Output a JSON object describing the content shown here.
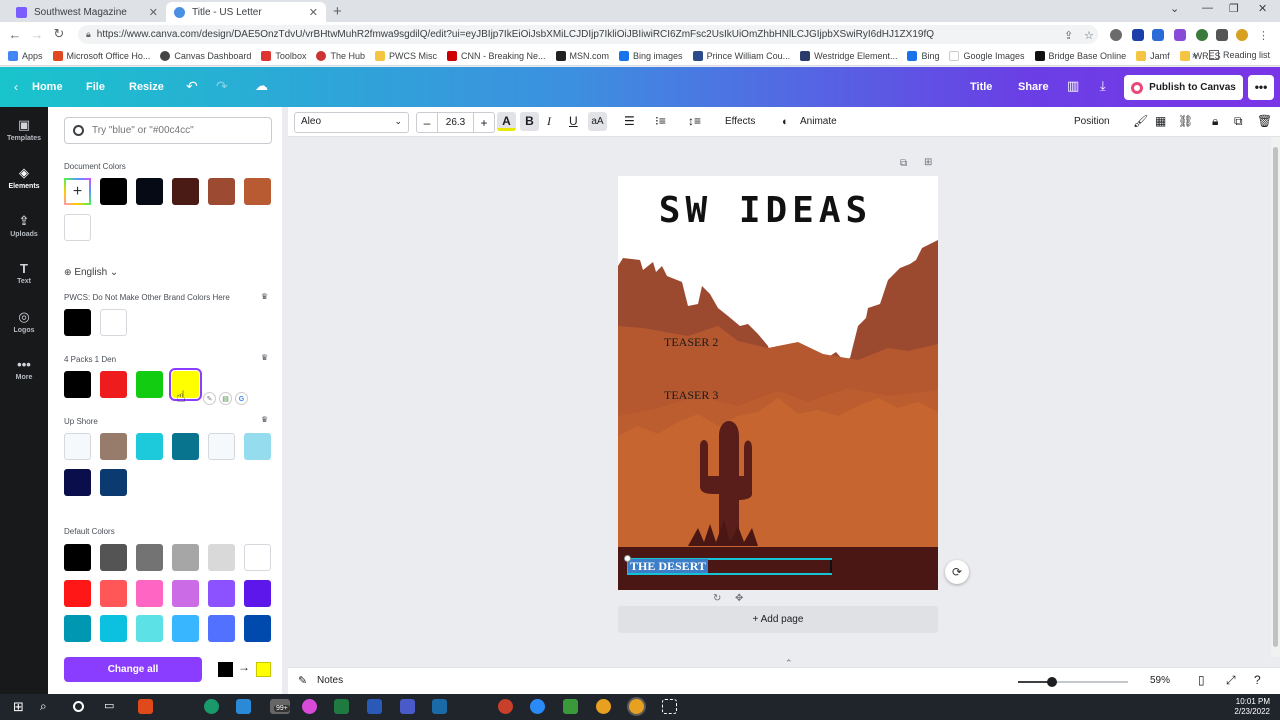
{
  "browser": {
    "tabs": [
      {
        "title": "Southwest Magazine",
        "active": false
      },
      {
        "title": "Title - US Letter",
        "active": true
      }
    ],
    "url": "https://www.canva.com/design/DAE5OnzTdvU/vrBHtwMuhR2fmwa9sgdilQ/edit?ui=eyJBIjp7IkEiOiJsbXMiLCJDIjp7IkliOiJBIiwiRCI6ZmFsc2UsIkUiOmZhbHNlLCJGIjpbXSwiRyI6dHJ1ZX19fQ",
    "bookmarks": [
      "Apps",
      "Microsoft Office Ho...",
      "Canvas Dashboard",
      "Toolbox",
      "The Hub",
      "PWCS Misc",
      "CNN - Breaking Ne...",
      "MSN.com",
      "Bing images",
      "Prince William Cou...",
      "Westridge Element...",
      "Bing",
      "Google Images",
      "Bridge Base Online",
      "Jamf",
      "WRES"
    ],
    "reading_list": "Reading list",
    "more": "»"
  },
  "topbar": {
    "home": "Home",
    "file": "File",
    "resize": "Resize",
    "title": "Title",
    "share": "Share",
    "publish": "Publish to Canvas",
    "more": "•••"
  },
  "rail": [
    {
      "label": "Templates",
      "icon": "templates-icon"
    },
    {
      "label": "Elements",
      "icon": "elements-icon",
      "active": true
    },
    {
      "label": "Uploads",
      "icon": "uploads-icon"
    },
    {
      "label": "Text",
      "icon": "text-icon"
    },
    {
      "label": "Logos",
      "icon": "logos-icon"
    },
    {
      "label": "More",
      "icon": "more-icon"
    }
  ],
  "panel": {
    "search_placeholder": "Try \"blue\" or \"#00c4cc\"",
    "document_colors_label": "Document Colors",
    "document_colors": [
      "#000000",
      "#050a14",
      "#4a1a14",
      "#9c4a32",
      "#b85a32",
      "#ffffff"
    ],
    "language": "English",
    "brand_label": "PWCS: Do Not Make Other Brand Colors Here",
    "brand_colors": [
      "#000000",
      "#ffffff"
    ],
    "packs_label": "4 Packs 1 Den",
    "packs_colors": [
      "#000000",
      "#ee1c1c",
      "#11cc11",
      "#ffff00"
    ],
    "upshore_label": "Up Shore",
    "upshore_colors": [
      "#f5f9fb",
      "#977b6b",
      "#1ccadc",
      "#09748e",
      "#f5f9fb",
      "#96dcef",
      "#0a0e4a",
      "#0a3a70"
    ],
    "default_label": "Default Colors",
    "default_colors": [
      "#000000",
      "#545454",
      "#737373",
      "#a6a6a6",
      "#d9d9d9",
      "#ffffff",
      "#ff1616",
      "#ff5757",
      "#ff66c4",
      "#cb6ce6",
      "#8c52ff",
      "#5e17eb",
      "#0097b2",
      "#0cc0df",
      "#5ce1e6",
      "#38b6ff",
      "#5271ff",
      "#004aad"
    ],
    "change_all": "Change all",
    "swap_from": "#000000",
    "swap_to": "#ffff00"
  },
  "toolbar": {
    "font": "Aleo",
    "size": "26.3",
    "minus": "–",
    "plus": "+",
    "effects": "Effects",
    "animate": "Animate",
    "position": "Position"
  },
  "canvas": {
    "title": "SW IDEAS",
    "teaser2": "TEASER 2",
    "teaser3": "TEASER 3",
    "selected_text": "THE DESERT",
    "add_page": "+ Add page"
  },
  "bottom": {
    "notes": "Notes",
    "zoom": "59%",
    "zoom_fraction": 0.59
  },
  "taskbar": {
    "badge": "99+",
    "time": "10:01 PM",
    "date": "2/23/2022"
  },
  "colors": {
    "canva_purple": "#8b3dff",
    "selection": "#16c3d5",
    "desert_dark": "#4a1714"
  }
}
